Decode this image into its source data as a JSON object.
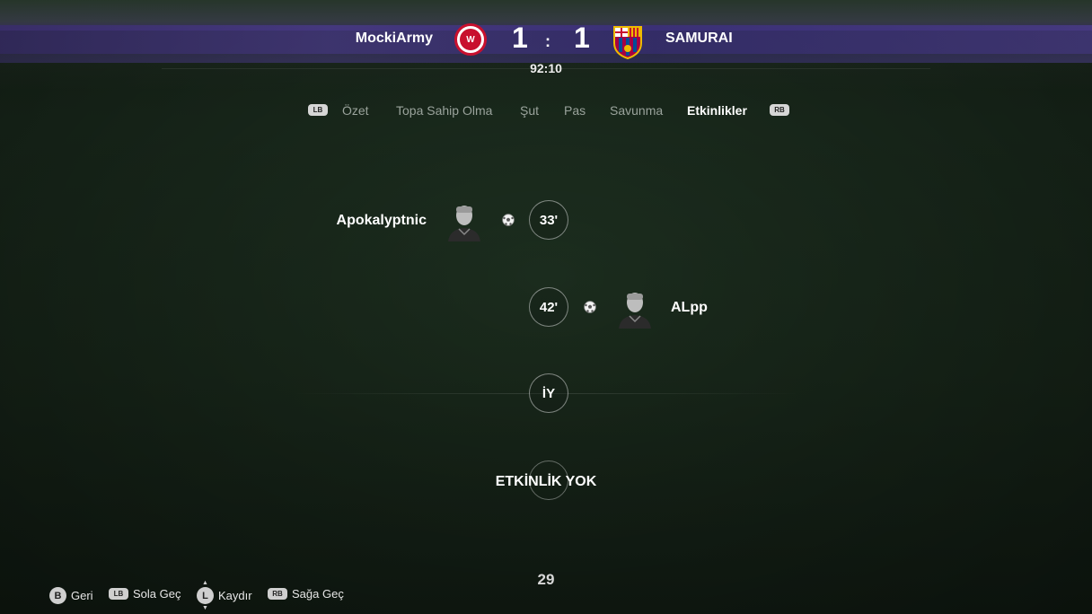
{
  "match": {
    "home": {
      "name": "MockiArmy",
      "score": "1",
      "crest_color": "#c8102e"
    },
    "away": {
      "name": "SAMURAI",
      "score": "1"
    },
    "separator": ":",
    "clock": "92:10"
  },
  "tabs": {
    "left_button": "LB",
    "right_button": "RB",
    "items": [
      {
        "label": "Özet"
      },
      {
        "label": "Topa Sahip Olma"
      },
      {
        "label": "Şut"
      },
      {
        "label": "Pas"
      },
      {
        "label": "Savunma"
      },
      {
        "label": "Etkinlikler",
        "active": true
      }
    ]
  },
  "events": [
    {
      "minute": "33'",
      "side": "home",
      "player": "Apokalyptnic",
      "type": "goal",
      "icon": "football-icon"
    },
    {
      "minute": "42'",
      "side": "away",
      "player": "ALpp",
      "type": "goal",
      "icon": "football-icon"
    }
  ],
  "half_marker": "İY",
  "no_events": "ETKİNLİK YOK",
  "page_number": "29",
  "footer": {
    "back": {
      "button": "B",
      "label": "Geri"
    },
    "prev": {
      "button": "LB",
      "label": "Sola Geç"
    },
    "scroll": {
      "button": "L",
      "label": "Kaydır"
    },
    "next": {
      "button": "RB",
      "label": "Sağa Geç"
    }
  }
}
